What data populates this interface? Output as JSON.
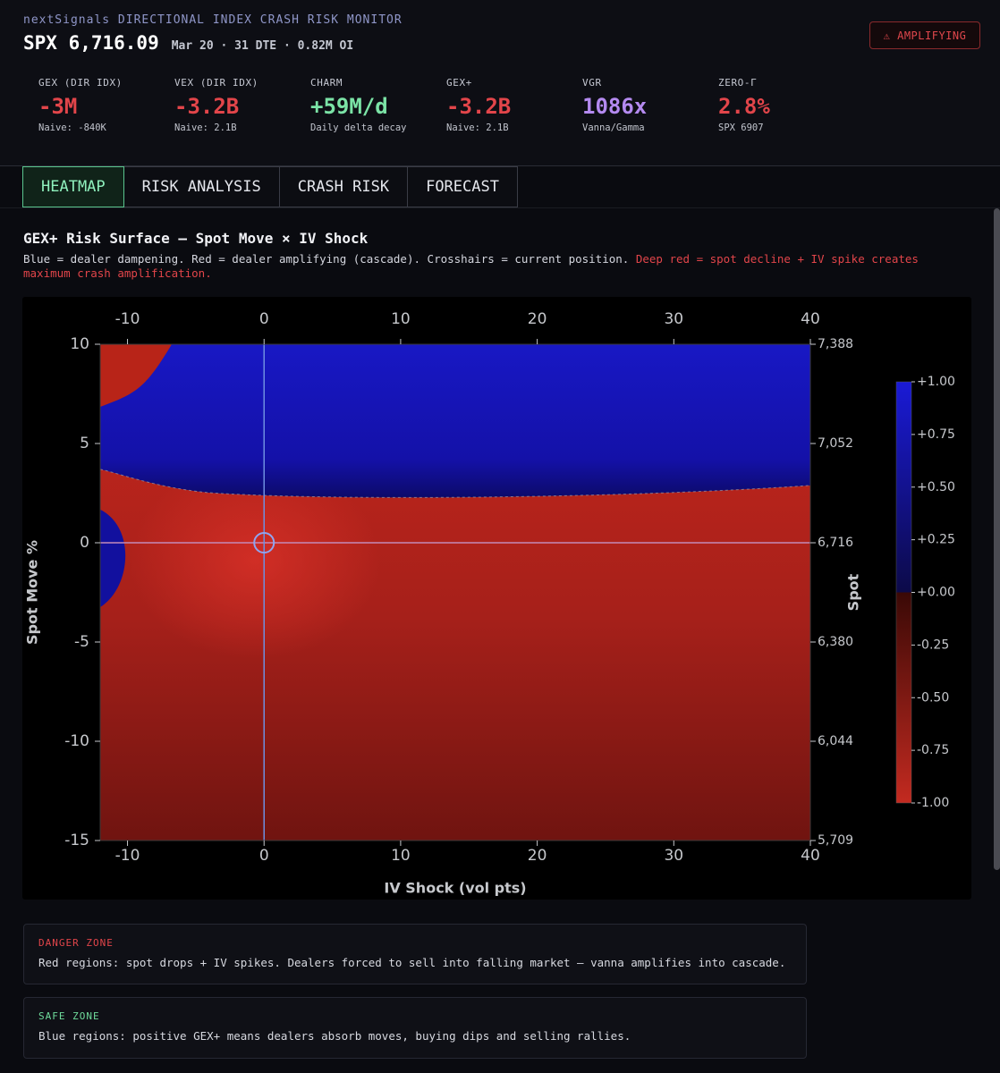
{
  "header": {
    "brand": "nextSignals DIRECTIONAL INDEX CRASH RISK MONITOR",
    "ticker": "SPX 6,716.09",
    "meta": "Mar 20 · 31 DTE · 0.82M OI",
    "badge": "⚠ AMPLIFYING"
  },
  "metrics": [
    {
      "label": "GEX (DIR IDX)",
      "value": "-3M",
      "sub": "Naive: -840K",
      "color": "#e2454a"
    },
    {
      "label": "VEX (DIR IDX)",
      "value": "-3.2B",
      "sub": "Naive: 2.1B",
      "color": "#e2454a"
    },
    {
      "label": "CHARM",
      "value": "+59M/d",
      "sub": "Daily delta decay",
      "color": "#7be3a6"
    },
    {
      "label": "GEX+",
      "value": "-3.2B",
      "sub": "Naive: 2.1B",
      "color": "#e2454a"
    },
    {
      "label": "VGR",
      "value": "1086x",
      "sub": "Vanna/Gamma",
      "color": "#b48af0"
    },
    {
      "label": "ZERO-Γ",
      "value": "2.8%",
      "sub": "SPX 6907",
      "color": "#e2454a"
    }
  ],
  "tabs": [
    "HEATMAP",
    "RISK ANALYSIS",
    "CRASH RISK",
    "FORECAST"
  ],
  "active_tab": "HEATMAP",
  "section": {
    "title": "GEX+ Risk Surface — Spot Move × IV Shock",
    "desc": "Blue = dealer dampening. Red = dealer amplifying (cascade). Crosshairs = current position.",
    "warn": "Deep red = spot decline + IV spike creates maximum crash amplification."
  },
  "chart_data": {
    "type": "heatmap",
    "xlabel": "IV Shock (vol pts)",
    "ylabel": "Spot Move %",
    "y2label": "Spot",
    "xlim": [
      -12,
      40
    ],
    "ylim": [
      -15,
      10
    ],
    "x_ticks": [
      -10,
      0,
      10,
      20,
      30,
      40
    ],
    "y_ticks": [
      10,
      5,
      0,
      -5,
      -10,
      -15
    ],
    "y2_ticks": [
      "7,388",
      "7,052",
      "6,716",
      "6,380",
      "6,044",
      "5,709"
    ],
    "colorbar_ticks": [
      "+1.00",
      "+0.75",
      "+0.50",
      "+0.25",
      "+0.00",
      "-0.25",
      "-0.50",
      "-0.75",
      "-1.00"
    ],
    "colorbar_range": [
      -1,
      1
    ],
    "current_position": {
      "iv_shock": 0,
      "spot_move": 0
    },
    "zero_gamma_spot_move": 2.8,
    "colors": {
      "positive": "#1515c8",
      "negative": "#c8261e",
      "zero": "#000000"
    }
  },
  "zones": {
    "danger": {
      "label": "DANGER ZONE",
      "text": "Red regions: spot drops + IV spikes. Dealers forced to sell into falling market — vanna amplifies into cascade."
    },
    "safe": {
      "label": "SAFE ZONE",
      "text": "Blue regions: positive GEX+ means dealers absorb moves, buying dips and selling rallies."
    }
  }
}
